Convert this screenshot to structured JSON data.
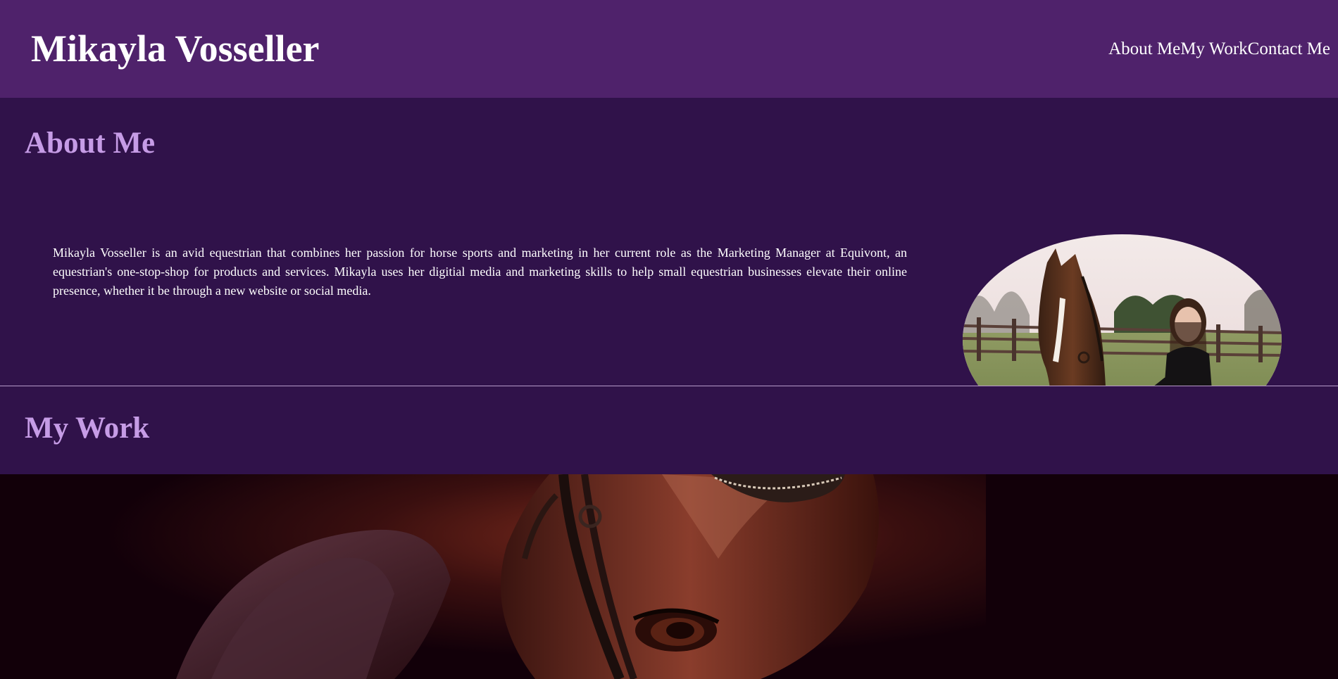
{
  "header": {
    "site_title": "Mikayla Vosseller",
    "nav": [
      {
        "label": "About Me"
      },
      {
        "label": "My Work"
      },
      {
        "label": "Contact Me"
      }
    ]
  },
  "about": {
    "heading": "About Me",
    "bio": "Mikayla Vosseller is an avid equestrian that combines her passion for horse sports and marketing in her current role as the Marketing Manager at Equivont, an equestrian's one-stop-shop for products and services. Mikayla uses her digitial media and marketing skills to help small equestrian businesses elevate their online presence, whether it be through a new website or social media.",
    "portrait_icon": "horse-and-rider-photo"
  },
  "work": {
    "heading": "My Work",
    "hero_icon": "horse-closeup-photo"
  },
  "colors": {
    "header_bg": "#4f226b",
    "section_bg": "#30124a",
    "heading_accent": "#c69ce6",
    "text": "#ffffff"
  }
}
